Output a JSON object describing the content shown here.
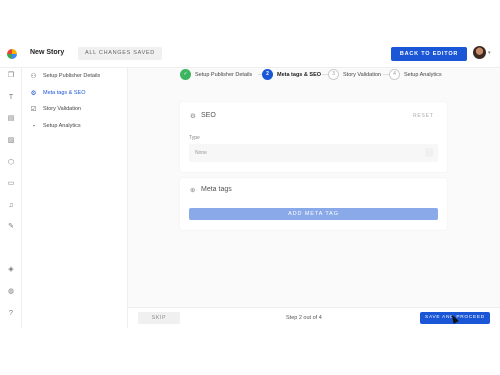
{
  "header": {
    "title": "New Story",
    "saved_status": "ALL CHANGES SAVED",
    "back_button": "BACK TO EDITOR",
    "logo_icon": "app-logo-icon",
    "avatar_icon": "user-avatar"
  },
  "rail": {
    "icons": [
      "copy-icon",
      "text-icon",
      "layout-icon",
      "image-icon",
      "shape-icon",
      "media-icon",
      "audio-icon",
      "pen-icon",
      "layers-icon",
      "globe-icon",
      "help-icon"
    ]
  },
  "sidebar": {
    "items": [
      {
        "label": "Setup Publisher Details",
        "icon": "user-icon",
        "active": false
      },
      {
        "label": "Meta tags & SEO",
        "icon": "gear-icon",
        "active": true
      },
      {
        "label": "Story Validation",
        "icon": "checkbox-icon",
        "active": false
      },
      {
        "label": "Setup Analytics",
        "icon": "chart-icon",
        "active": false
      }
    ]
  },
  "stepper": {
    "steps": [
      {
        "number": "✓",
        "label": "Setup Publisher Details",
        "state": "done"
      },
      {
        "number": "2",
        "label": "Meta tags & SEO",
        "state": "current"
      },
      {
        "number": "3",
        "label": "Story Validation",
        "state": "todo"
      },
      {
        "number": "4",
        "label": "Setup Analytics",
        "state": "todo"
      }
    ]
  },
  "seo": {
    "title": "SEO",
    "reset": "RESET",
    "type_label": "Type",
    "type_value": "None"
  },
  "meta": {
    "title": "Meta tags",
    "add_button": "ADD META TAG"
  },
  "footer": {
    "skip": "SKIP",
    "step_count": "Step 2 out of 4",
    "save_button": "SAVE AND PROCEED"
  },
  "colors": {
    "accent": "#1a56d6",
    "done": "#3cb55e",
    "disabled_accent": "#8aa9e8"
  }
}
